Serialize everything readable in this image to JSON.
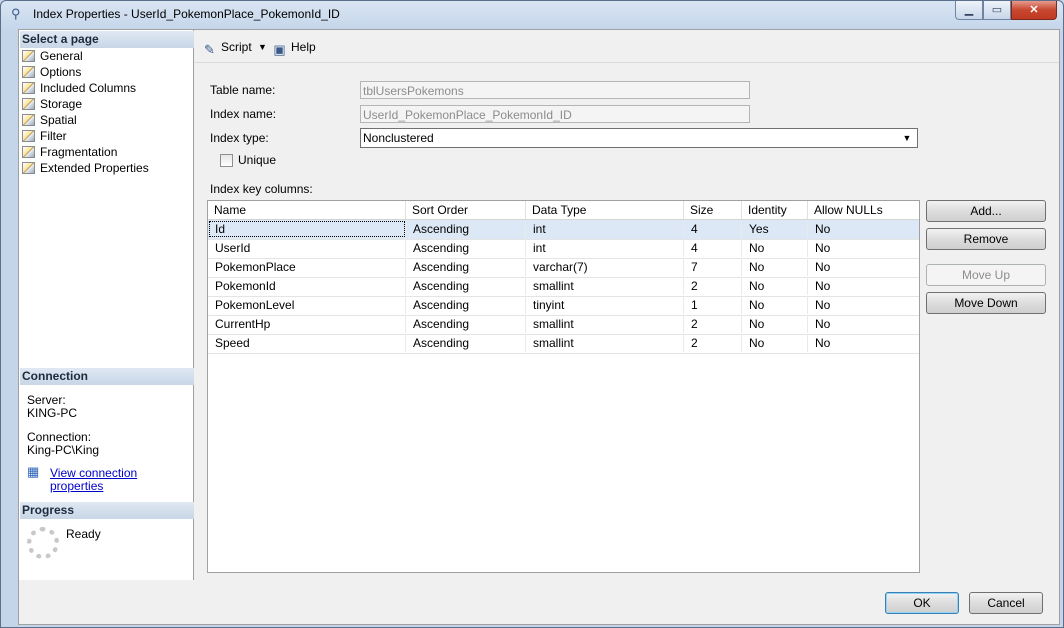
{
  "window": {
    "title": "Index Properties - UserId_PokemonPlace_PokemonId_ID"
  },
  "sidebar": {
    "header": "Select a page",
    "items": [
      "General",
      "Options",
      "Included Columns",
      "Storage",
      "Spatial",
      "Filter",
      "Fragmentation",
      "Extended Properties"
    ]
  },
  "connection": {
    "header": "Connection",
    "server_label": "Server:",
    "server_value": "KING-PC",
    "connection_label": "Connection:",
    "connection_value": "King-PC\\King",
    "link": "View connection properties"
  },
  "progress": {
    "header": "Progress",
    "status": "Ready"
  },
  "toolbar": {
    "script": "Script",
    "help": "Help"
  },
  "form": {
    "table_name_label": "Table name:",
    "table_name_value": "tblUsersPokemons",
    "index_name_label": "Index name:",
    "index_name_value": "UserId_PokemonPlace_PokemonId_ID",
    "index_type_label": "Index type:",
    "index_type_value": "Nonclustered",
    "unique_label": "Unique",
    "key_columns_label": "Index key columns:"
  },
  "grid": {
    "headers": [
      "Name",
      "Sort Order",
      "Data Type",
      "Size",
      "Identity",
      "Allow NULLs"
    ],
    "rows": [
      [
        "Id",
        "Ascending",
        "int",
        "4",
        "Yes",
        "No"
      ],
      [
        "UserId",
        "Ascending",
        "int",
        "4",
        "No",
        "No"
      ],
      [
        "PokemonPlace",
        "Ascending",
        "varchar(7)",
        "7",
        "No",
        "No"
      ],
      [
        "PokemonId",
        "Ascending",
        "smallint",
        "2",
        "No",
        "No"
      ],
      [
        "PokemonLevel",
        "Ascending",
        "tinyint",
        "1",
        "No",
        "No"
      ],
      [
        "CurrentHp",
        "Ascending",
        "smallint",
        "2",
        "No",
        "No"
      ],
      [
        "Speed",
        "Ascending",
        "smallint",
        "2",
        "No",
        "No"
      ]
    ]
  },
  "buttons": {
    "add": "Add...",
    "remove": "Remove",
    "move_up": "Move Up",
    "move_down": "Move Down",
    "ok": "OK",
    "cancel": "Cancel"
  }
}
